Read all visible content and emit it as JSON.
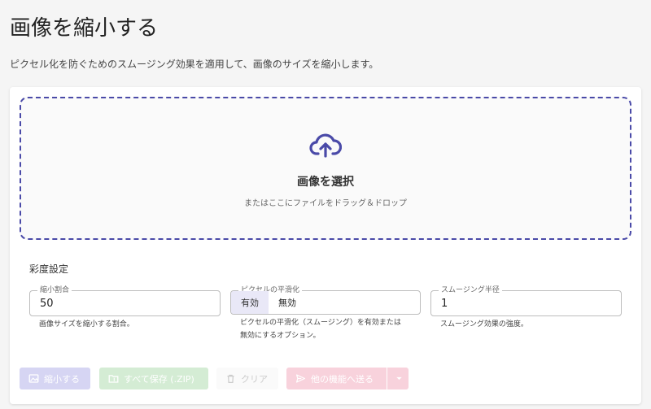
{
  "page": {
    "title": "画像を縮小する",
    "description": "ピクセル化を防ぐためのスムージング効果を適用して、画像のサイズを縮小します。"
  },
  "dropzone": {
    "icon": "cloud-upload-icon",
    "title": "画像を選択",
    "subtitle": "またはここにファイルをドラッグ＆ドロップ"
  },
  "settings": {
    "section_title": "彩度設定",
    "scale": {
      "label": "縮小割合",
      "value": "50",
      "helper": "画像サイズを縮小する割合。"
    },
    "smoothing": {
      "label": "ピクセルの平滑化",
      "options": [
        "有効",
        "無効"
      ],
      "selected": "有効",
      "helper_line1": "ピクセルの平滑化（スムージング）を有効または",
      "helper_line2": "無効にするオプション。"
    },
    "radius": {
      "label": "スムージング半径",
      "value": "1",
      "helper": "スムージング効果の強度。"
    }
  },
  "actions": {
    "shrink": "縮小する",
    "save_all": "すべて保存 (.ZIP)",
    "clear": "クリア",
    "send": "他の機能へ送る"
  },
  "colors": {
    "accent": "#4a4aa8",
    "primary_disabled": "#d6d5f3",
    "success_disabled": "#d4ecd4",
    "pink_disabled": "#f8d2dc"
  }
}
